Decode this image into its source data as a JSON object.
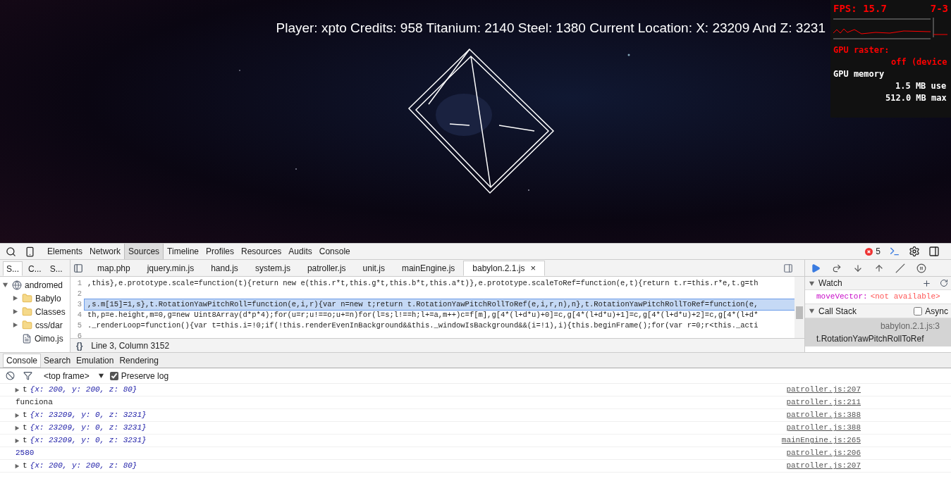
{
  "game": {
    "hud": "Player: xpto Credits: 958 Titanium: 2140 Steel: 1380 Current Location: X: 23209 And Z: 3231",
    "stats": {
      "fps": "FPS: 15.7",
      "fps_range": "7-3",
      "raster_label": "GPU raster:",
      "raster_value": "off (device",
      "memory_label": "GPU memory",
      "memory_used": "1.5 MB use",
      "memory_max": "512.0 MB max"
    }
  },
  "devtools": {
    "panels": [
      {
        "label": "Elements",
        "selected": false
      },
      {
        "label": "Network",
        "selected": false
      },
      {
        "label": "Sources",
        "selected": true
      },
      {
        "label": "Timeline",
        "selected": false
      },
      {
        "label": "Profiles",
        "selected": false
      },
      {
        "label": "Resources",
        "selected": false
      },
      {
        "label": "Audits",
        "selected": false
      },
      {
        "label": "Console",
        "selected": false
      }
    ],
    "error_count": "5",
    "navigator_tabs": [
      {
        "label": "S...",
        "selected": true
      },
      {
        "label": "C...",
        "selected": false
      },
      {
        "label": "S...",
        "selected": false
      }
    ],
    "tree": [
      {
        "label": "andromed",
        "kind": "site",
        "expanded": true,
        "children": [
          {
            "label": "Babylo",
            "kind": "folder",
            "expanded": false
          },
          {
            "label": "Classes",
            "kind": "folder",
            "expanded": false
          },
          {
            "label": "css/dar",
            "kind": "folder",
            "expanded": false
          },
          {
            "label": "Oimo.js",
            "kind": "file"
          }
        ]
      }
    ],
    "files": [
      {
        "label": "map.php",
        "selected": false
      },
      {
        "label": "jquery.min.js",
        "selected": false
      },
      {
        "label": "hand.js",
        "selected": false
      },
      {
        "label": "system.js",
        "selected": false
      },
      {
        "label": "patroller.js",
        "selected": false
      },
      {
        "label": "unit.js",
        "selected": false
      },
      {
        "label": "mainEngine.js",
        "selected": false
      },
      {
        "label": "babylon.2.1.js",
        "selected": true
      }
    ],
    "close_glyph": "×",
    "code": [
      {
        "number": "1",
        "text": ",this},e.prototype.scale=function(t){return new e(this.r*t,this.g*t,this.b*t,this.a*t)},e.prototype.scaleToRef=function(e,t){return t.r=this.r*e,t.g=th",
        "selected": false
      },
      {
        "number": "2",
        "selected": false
      },
      {
        "number": "3",
        "text": ",s.m[15]=1,s},t.RotationYawPitchRoll=function(e,i,r){var n=new t;return t.RotationYawPitchRollToRef(e,i,r,n),n},t.RotationYawPitchRollToRef=function(e,",
        "selected": true
      },
      {
        "number": "4",
        "text": "th,p=e.height,m=0,g=new Uint8Array(d*p*4);for(u=r;u!==o;u+=n)for(l=s;l!==h;l+=a,m++)c=f[m],g[4*(l+d*u)+0]=c,g[4*(l+d*u)+1]=c,g[4*(l+d*u)+2]=c,g[4*(l+d*",
        "selected": false
      },
      {
        "number": "5",
        "text": "._renderLoop=function(){var t=this.i=!0;if(!this.renderEvenInBackground&&this._windowIsBackground&&(i=!1),i){this.beginFrame();for(var r=0;r<this._acti",
        "selected": false
      },
      {
        "number": "6",
        "selected": false
      }
    ],
    "pretty_print": "{}",
    "cursor_position": "Line 3, Column 3152",
    "watch": {
      "title": "Watch",
      "expanded": true,
      "expressions": [
        {
          "name": "moveVector:",
          "value": "<not available>"
        }
      ]
    },
    "call_stack": {
      "title": "Call Stack",
      "expanded": true,
      "async_label": "Async",
      "async_checked": false,
      "frames": [
        {
          "file": "babylon.2.1.js:3",
          "function": "t.RotationYawPitchRollToRef",
          "selected": true
        }
      ]
    },
    "drawer_tabs": [
      {
        "label": "Console",
        "selected": true
      },
      {
        "label": "Search",
        "selected": false
      },
      {
        "label": "Emulation",
        "selected": false
      },
      {
        "label": "Rendering",
        "selected": false
      }
    ],
    "console": {
      "context": "<top frame>",
      "preserve_log": "Preserve log",
      "preserve_checked": true,
      "messages": [
        {
          "kind": "object",
          "name": "t",
          "value": "{x: 200, y: 200, z: 80}",
          "source": "patroller.js:207"
        },
        {
          "kind": "text",
          "text": "funciona",
          "source": "patroller.js:211"
        },
        {
          "kind": "object",
          "name": "t",
          "value": "{x: 23209, y: 0, z: 3231}",
          "source": "patroller.js:388"
        },
        {
          "kind": "object",
          "name": "t",
          "value": "{x: 23209, y: 0, z: 3231}",
          "source": "patroller.js:388"
        },
        {
          "kind": "object",
          "name": "t",
          "value": "{x: 23209, y: 0, z: 3231}",
          "source": "mainEngine.js:265"
        },
        {
          "kind": "number",
          "text": "2580",
          "source": "patroller.js:206"
        },
        {
          "kind": "object",
          "name": "t",
          "value": "{x: 200, y: 200, z: 80}",
          "source": "patroller.js:207"
        }
      ]
    }
  }
}
